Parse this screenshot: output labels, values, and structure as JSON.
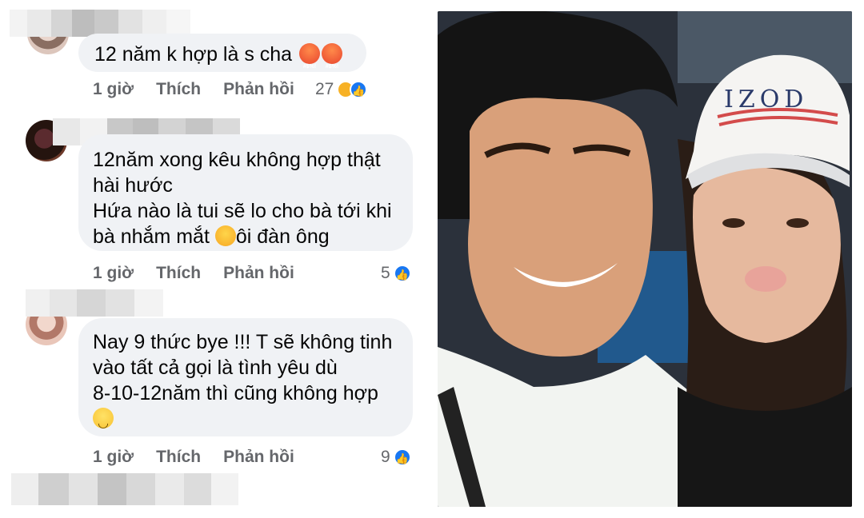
{
  "comments": [
    {
      "lines": [
        "12 năm k hợp là s cha"
      ],
      "actions": {
        "time": "1 giờ",
        "like": "Thích",
        "reply": "Phản hồi"
      },
      "reaction_count": "27",
      "emoji": [
        "angry-face-icon",
        "angry-face-icon"
      ]
    },
    {
      "lines": [
        "12năm xong kêu không hợp thật",
        "hài hước",
        "Hứa nào là tui sẽ lo cho bà tới khi",
        "bà nhắm mắt",
        "ôi đàn ông"
      ],
      "actions": {
        "time": "1 giờ",
        "like": "Thích",
        "reply": "Phản hồi"
      },
      "reaction_count": "5",
      "emoji": [
        "laughing-face-icon"
      ]
    },
    {
      "lines": [
        "Nay 9 thức bye !!!  T sẽ không tinh",
        "vào tất cả gọi là tình yêu dù",
        "8-10-12năm thì cũng không hợp"
      ],
      "actions": {
        "time": "1 giờ",
        "like": "Thích",
        "reply": "Phản hồi"
      },
      "reaction_count": "9",
      "emoji": [
        "smile-face-icon"
      ]
    }
  ],
  "photo": {
    "cap_text": "IZOD"
  },
  "colors": {
    "bubble": "#f0f2f5",
    "secondary_text": "#65676b",
    "like_blue": "#1877f2"
  }
}
